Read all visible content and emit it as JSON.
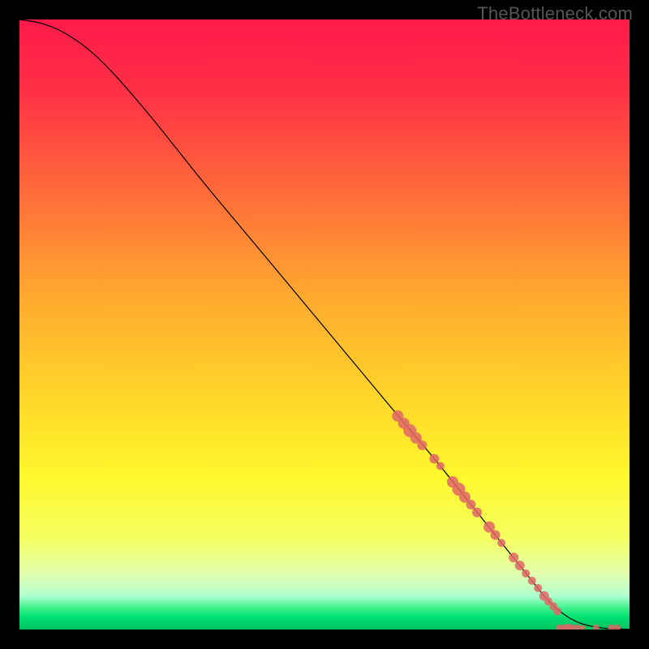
{
  "watermark": "TheBottleneck.com",
  "chart_data": {
    "type": "line",
    "title": "",
    "xlabel": "",
    "ylabel": "",
    "xlim": [
      0,
      100
    ],
    "ylim": [
      0,
      100
    ],
    "grid": false,
    "legend": false,
    "background_gradient": {
      "stops": [
        {
          "offset": 0.0,
          "color": "#ff1a4a"
        },
        {
          "offset": 0.12,
          "color": "#ff3045"
        },
        {
          "offset": 0.28,
          "color": "#ff6a3a"
        },
        {
          "offset": 0.45,
          "color": "#ffa82f"
        },
        {
          "offset": 0.62,
          "color": "#ffd629"
        },
        {
          "offset": 0.75,
          "color": "#fff82c"
        },
        {
          "offset": 0.85,
          "color": "#f6ff60"
        },
        {
          "offset": 0.91,
          "color": "#e0ffb0"
        },
        {
          "offset": 0.945,
          "color": "#b0ffd0"
        },
        {
          "offset": 0.965,
          "color": "#3cf28a"
        },
        {
          "offset": 0.98,
          "color": "#00e070"
        },
        {
          "offset": 1.0,
          "color": "#00c060"
        }
      ]
    },
    "series": [
      {
        "name": "curve",
        "type": "line",
        "color": "#000000",
        "width": 1.2,
        "x": [
          0,
          3,
          6,
          9,
          12,
          16,
          22,
          30,
          40,
          50,
          60,
          68,
          74,
          80,
          84,
          86,
          88,
          90,
          92,
          94,
          96,
          98,
          100
        ],
        "y": [
          100,
          99.5,
          98.5,
          96.8,
          94.5,
          90.5,
          83.5,
          73.5,
          61.5,
          49.5,
          37.5,
          28.0,
          20.5,
          13.0,
          8.0,
          5.5,
          3.5,
          2.0,
          1.0,
          0.5,
          0.2,
          0.1,
          0.05
        ]
      },
      {
        "name": "highlight-dots",
        "type": "scatter",
        "color": "#e06666",
        "radius_min": 3,
        "radius_max": 8,
        "points": [
          {
            "x": 62,
            "y": 35.0,
            "r": 7
          },
          {
            "x": 63,
            "y": 33.8,
            "r": 7
          },
          {
            "x": 64,
            "y": 32.6,
            "r": 8
          },
          {
            "x": 65,
            "y": 31.4,
            "r": 7
          },
          {
            "x": 66,
            "y": 30.2,
            "r": 6
          },
          {
            "x": 68,
            "y": 28.0,
            "r": 6
          },
          {
            "x": 69,
            "y": 26.8,
            "r": 5
          },
          {
            "x": 71,
            "y": 24.2,
            "r": 7
          },
          {
            "x": 72,
            "y": 23.0,
            "r": 8
          },
          {
            "x": 73,
            "y": 21.7,
            "r": 7
          },
          {
            "x": 74,
            "y": 20.5,
            "r": 6
          },
          {
            "x": 75,
            "y": 19.2,
            "r": 6
          },
          {
            "x": 77,
            "y": 16.8,
            "r": 7
          },
          {
            "x": 78,
            "y": 15.5,
            "r": 6
          },
          {
            "x": 79,
            "y": 14.2,
            "r": 5
          },
          {
            "x": 81,
            "y": 11.8,
            "r": 6
          },
          {
            "x": 82,
            "y": 10.5,
            "r": 6
          },
          {
            "x": 83,
            "y": 9.2,
            "r": 5
          },
          {
            "x": 84,
            "y": 8.0,
            "r": 5
          },
          {
            "x": 85,
            "y": 6.8,
            "r": 5
          },
          {
            "x": 86,
            "y": 5.5,
            "r": 6
          },
          {
            "x": 86.7,
            "y": 4.6,
            "r": 5
          },
          {
            "x": 87.5,
            "y": 3.8,
            "r": 5
          },
          {
            "x": 88.2,
            "y": 3.0,
            "r": 5
          },
          {
            "x": 88.5,
            "y": 0.3,
            "r": 4
          },
          {
            "x": 89.3,
            "y": 0.3,
            "r": 4
          },
          {
            "x": 90.0,
            "y": 0.3,
            "r": 5
          },
          {
            "x": 90.7,
            "y": 0.3,
            "r": 4
          },
          {
            "x": 91.5,
            "y": 0.3,
            "r": 4
          },
          {
            "x": 92.3,
            "y": 0.3,
            "r": 3
          },
          {
            "x": 94.5,
            "y": 0.3,
            "r": 4
          },
          {
            "x": 97.0,
            "y": 0.3,
            "r": 4
          },
          {
            "x": 98.0,
            "y": 0.3,
            "r": 4
          }
        ]
      }
    ]
  }
}
